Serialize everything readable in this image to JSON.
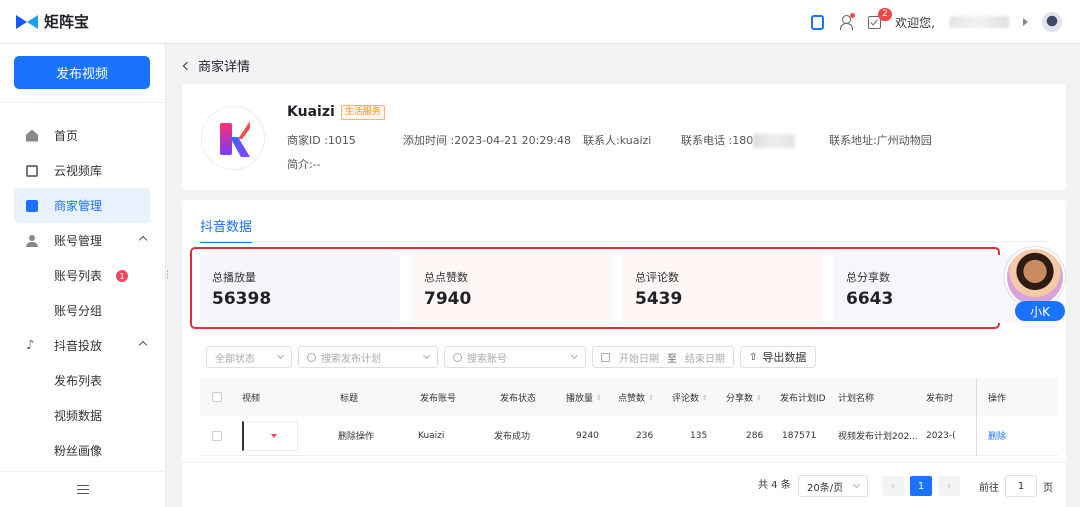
{
  "header": {
    "app_name": "矩阵宝",
    "notification_count": "2",
    "welcome": "欢迎您,"
  },
  "sidebar": {
    "publish_label": "发布视频",
    "items": [
      {
        "label": "首页",
        "icon": "home-icon"
      },
      {
        "label": "云视频库",
        "icon": "cloud-library-icon"
      },
      {
        "label": "商家管理",
        "icon": "shop-icon",
        "active": true
      },
      {
        "label": "账号管理",
        "icon": "user-icon",
        "expanded": true
      },
      {
        "label": "账号列表",
        "badge": "1"
      },
      {
        "label": "账号分组"
      },
      {
        "label": "抖音投放",
        "icon": "tiktok-icon",
        "expanded": true
      },
      {
        "label": "发布列表"
      },
      {
        "label": "视频数据"
      },
      {
        "label": "粉丝画像"
      }
    ]
  },
  "breadcrumb": {
    "title": "商家详情"
  },
  "merchant": {
    "name": "Kuaizi",
    "tag": "生活服务",
    "id": "商家ID :1015",
    "added": "添加时间 :2023-04-21 20:29:48",
    "contact": "联系人:kuaizi",
    "phone": "联系电话 :180",
    "address": "联系地址:广州动物园",
    "intro": "简介:--"
  },
  "tab": {
    "label": "抖音数据"
  },
  "stats": [
    {
      "label": "总播放量",
      "value": "56398",
      "bg": "#f4f6fb"
    },
    {
      "label": "总点赞数",
      "value": "7940",
      "bg": "#fff7f6"
    },
    {
      "label": "总评论数",
      "value": "5439",
      "bg": "#fff6f6"
    },
    {
      "label": "总分享数",
      "value": "6643",
      "bg": "#f6f6fc"
    }
  ],
  "avatar": {
    "name": "小K"
  },
  "filters": {
    "status_placeholder": "全部状态",
    "plan_placeholder": "搜索发布计划",
    "account_placeholder": "搜索账号",
    "start_date": "开始日期",
    "date_sep": "至",
    "end_date": "结束日期",
    "export_label": "导出数据"
  },
  "table": {
    "headers": [
      "视频",
      "标题",
      "发布账号",
      "发布状态",
      "播放量",
      "点赞数",
      "评论数",
      "分享数",
      "发布计划ID",
      "计划名称",
      "发布时",
      "操作"
    ],
    "rows": [
      {
        "title": "删除操作",
        "account": "Kuaizi",
        "status": "发布成功",
        "plays": "9240",
        "likes": "236",
        "comments": "135",
        "shares": "286",
        "plan_id": "187571",
        "plan_name": "视频发布计划202...",
        "time": "2023-(",
        "action": "删除"
      }
    ]
  },
  "pagination": {
    "total": "共 4 条",
    "page_size": "20条/页",
    "current_page": "1",
    "goto_label": "前往",
    "goto_value": "1",
    "page_unit": "页"
  }
}
